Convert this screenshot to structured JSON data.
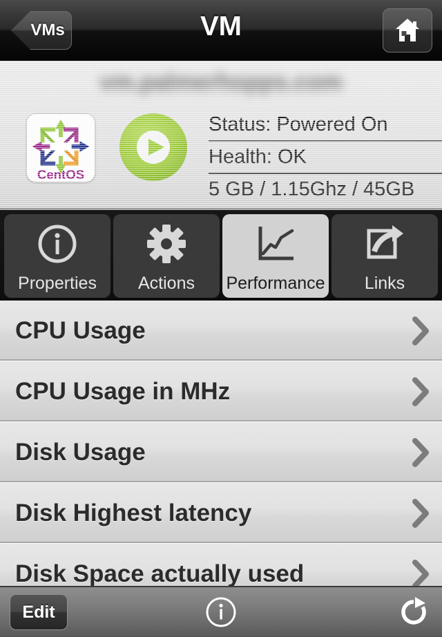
{
  "navbar": {
    "back_label": "VMs",
    "title": "VM",
    "home_icon": "home-icon"
  },
  "header": {
    "hostname": "vm.palmerhopps.com",
    "os_logo": {
      "name": "centos-logo",
      "label": "CentOS"
    },
    "power_state_icon": "play-circle-icon",
    "power_state_color": "#9fcc3b",
    "info_rows": [
      {
        "label": "Status: Powered On"
      },
      {
        "label": "Health: OK"
      },
      {
        "label": "5 GB / 1.15Ghz / 45GB"
      }
    ]
  },
  "tabs": [
    {
      "label": "Properties",
      "icon": "info-circle-icon",
      "active": false
    },
    {
      "label": "Actions",
      "icon": "gear-icon",
      "active": false
    },
    {
      "label": "Performance",
      "icon": "line-chart-icon",
      "active": true
    },
    {
      "label": "Links",
      "icon": "external-link-icon",
      "active": false
    }
  ],
  "list": {
    "rows": [
      {
        "label": "CPU Usage",
        "chevron": "chevron-right-icon"
      },
      {
        "label": "CPU Usage in MHz",
        "chevron": "chevron-right-icon"
      },
      {
        "label": "Disk Usage",
        "chevron": "chevron-right-icon"
      },
      {
        "label": "Disk Highest latency",
        "chevron": "chevron-right-icon"
      },
      {
        "label": "Disk Space actually used",
        "chevron": "chevron-right-icon"
      }
    ]
  },
  "toolbar": {
    "edit_label": "Edit",
    "info_icon": "info-circle-icon",
    "refresh_icon": "refresh-icon"
  }
}
